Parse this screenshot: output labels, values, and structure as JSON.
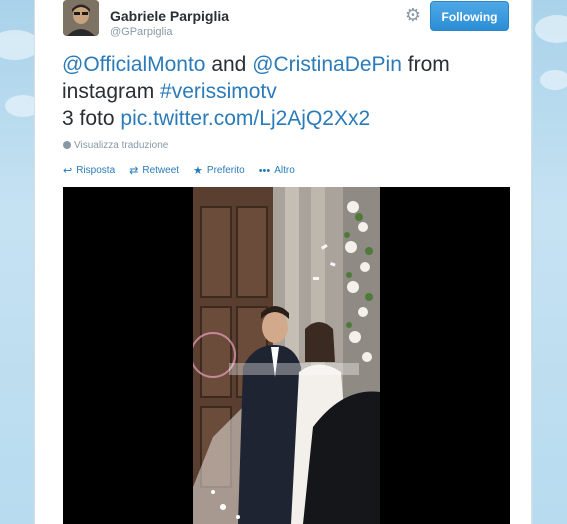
{
  "author": {
    "name": "Gabriele Parpiglia",
    "handle": "@GParpiglia",
    "avatar_icon": "user-avatar-photo"
  },
  "header": {
    "settings_icon": "gear-icon",
    "follow_label": "Following"
  },
  "tweet": {
    "mention1": "@OfficialMonto",
    "word_and": " and ",
    "mention2": "@CristinaDePin",
    "word_from": " from",
    "word_instagram": "instagram ",
    "hashtag": "#verissimotv",
    "count_text": "3 foto ",
    "link": "pic.twitter.com/Lj2AjQ2Xx2"
  },
  "translate_label": "Visualizza traduzione",
  "actions": {
    "reply": "Risposta",
    "retweet": "Retweet",
    "favorite": "Preferito",
    "more": "Altro"
  },
  "colors": {
    "link": "#2b7bb9",
    "follow_button": "#2c8ed6",
    "background": "#c0deed"
  }
}
